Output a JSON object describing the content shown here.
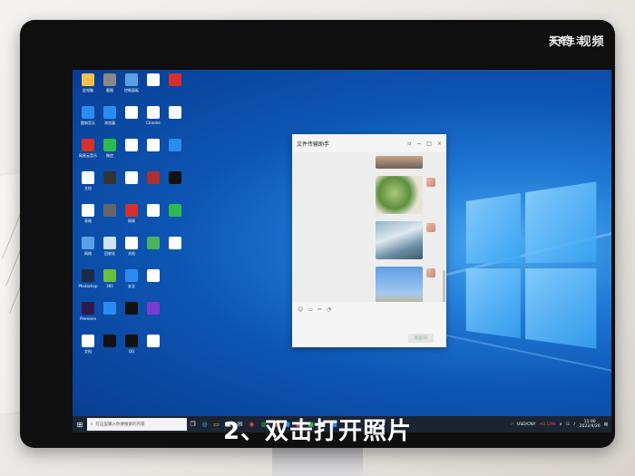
{
  "watermark": {
    "brand": "天奇生活",
    "overlay": "天奇 视频"
  },
  "caption": "2、双击打开照片",
  "desktop_icons": [
    {
      "label": "此电脑",
      "icon": "computer-icon",
      "color": "#f2c14e"
    },
    {
      "label": "酷狗音乐",
      "icon": "music-icon",
      "color": "#2a8cf0"
    },
    {
      "label": "网易云音乐",
      "icon": "netease-icon",
      "color": "#d7302a"
    },
    {
      "label": "文档",
      "icon": "doc-icon",
      "color": "#ffffff"
    },
    {
      "label": "表格",
      "icon": "doc-icon",
      "color": "#ffffff"
    },
    {
      "label": "网络",
      "icon": "network-icon",
      "color": "#5aa0e6"
    },
    {
      "label": "Photoshop",
      "icon": "ps-icon",
      "color": "#1e2a4a"
    },
    {
      "label": "Premiere",
      "icon": "pr-icon",
      "color": "#2b1a4a"
    },
    {
      "label": "文档",
      "icon": "doc-icon",
      "color": "#ffffff"
    },
    {
      "label": "截图",
      "icon": "image-icon",
      "color": "#888888"
    },
    {
      "label": "浏览器",
      "icon": "browser-icon",
      "color": "#2a8cf0"
    },
    {
      "label": "微信",
      "icon": "wechat-icon",
      "color": "#2dbb4e"
    },
    {
      "label": "",
      "icon": "person-icon",
      "color": "#333333"
    },
    {
      "label": "",
      "icon": "image-icon",
      "color": "#666666"
    },
    {
      "label": "回收站",
      "icon": "recycle-icon",
      "color": "#cfe3f7"
    },
    {
      "label": "360",
      "icon": "shield-icon",
      "color": "#6bbf3a"
    },
    {
      "label": "",
      "icon": "cursor-icon",
      "color": "#2a8cf0"
    },
    {
      "label": "",
      "icon": "black-icon",
      "color": "#111111"
    },
    {
      "label": "控制面板",
      "icon": "panel-icon",
      "color": "#5aa0e6"
    },
    {
      "label": "",
      "icon": "doc-icon",
      "color": "#ffffff"
    },
    {
      "label": "",
      "icon": "doc-icon",
      "color": "#ffffff"
    },
    {
      "label": "",
      "icon": "doc-icon",
      "color": "#ffffff"
    },
    {
      "label": "网易",
      "icon": "netease-icon",
      "color": "#d7302a"
    },
    {
      "label": "文档",
      "icon": "doc-icon",
      "color": "#ffffff"
    },
    {
      "label": "安全",
      "icon": "shield-icon",
      "color": "#2a8cf0"
    },
    {
      "label": "",
      "icon": "black-icon",
      "color": "#111111"
    },
    {
      "label": "QQ",
      "icon": "qq-icon",
      "color": "#111111"
    },
    {
      "label": "",
      "icon": "app-icon",
      "color": "#ffffff"
    },
    {
      "label": "Chrome",
      "icon": "chrome-icon",
      "color": "#ffffff"
    },
    {
      "label": "",
      "icon": "camera-icon",
      "color": "#ffffff"
    },
    {
      "label": "",
      "icon": "app-icon",
      "color": "#b03030"
    },
    {
      "label": "",
      "icon": "app-icon",
      "color": "#ffffff"
    },
    {
      "label": "",
      "icon": "app-icon",
      "color": "#4ab35a"
    },
    {
      "label": "",
      "icon": "doc-icon",
      "color": "#ffffff"
    },
    {
      "label": "",
      "icon": "app-icon",
      "color": "#7a3ccf"
    },
    {
      "label": "",
      "icon": "app-icon",
      "color": "#ffffff"
    },
    {
      "label": "",
      "icon": "app-icon",
      "color": "#d7302a"
    },
    {
      "label": "",
      "icon": "doc-icon",
      "color": "#ffffff"
    },
    {
      "label": "",
      "icon": "app-icon",
      "color": "#2a8cf0"
    },
    {
      "label": "",
      "icon": "app-icon",
      "color": "#111111"
    },
    {
      "label": "",
      "icon": "app-icon",
      "color": "#2dbb4e"
    },
    {
      "label": "",
      "icon": "doc-icon",
      "color": "#ffffff"
    }
  ],
  "chat_window": {
    "title": "文件传输助手",
    "controls": [
      "▫",
      "−",
      "□",
      "×"
    ],
    "send_label": "发送(S)",
    "toolbar_icons": [
      "emoji-icon",
      "folder-icon",
      "scissors-icon",
      "chat-history-icon"
    ]
  },
  "taskbar": {
    "search_placeholder": "在这里输入你要搜索的内容",
    "apps": [
      "task-view-icon",
      "edge-icon",
      "folder-icon",
      "store-icon",
      "mail-icon",
      "netease-icon",
      "wechat-icon",
      "app-icon",
      "app-icon",
      "app-icon",
      "app-icon",
      "app-icon",
      "app-icon"
    ],
    "currency": "USD/CNY",
    "change": "+0.10%",
    "time": "11:00",
    "date": "2022/4/26"
  }
}
